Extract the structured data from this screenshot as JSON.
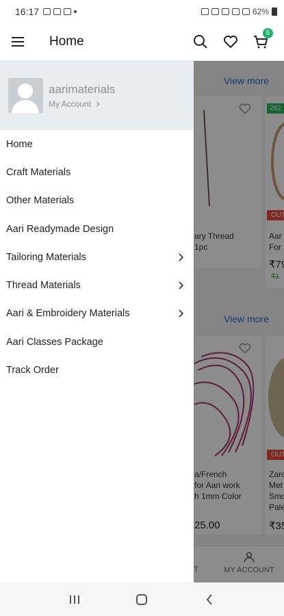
{
  "status_bar": {
    "time": "16:17",
    "battery": "62%"
  },
  "header": {
    "title": "Home",
    "cart_count": "6"
  },
  "drawer": {
    "username": "aarimaterials",
    "account_label": "My Account",
    "items": [
      {
        "label": "Home",
        "has_children": false
      },
      {
        "label": "Craft Materials",
        "has_children": false
      },
      {
        "label": "Other Materials",
        "has_children": false
      },
      {
        "label": "Aari Readymade Design",
        "has_children": false
      },
      {
        "label": "Tailoring Materials",
        "has_children": true
      },
      {
        "label": "Thread Materials",
        "has_children": true
      },
      {
        "label": "Aari & Embroidery Materials",
        "has_children": true
      },
      {
        "label": "Aari Classes Package",
        "has_children": false
      },
      {
        "label": "Track Order",
        "has_children": false
      }
    ]
  },
  "background": {
    "view_more_1": "View more",
    "view_more_2": "View more",
    "product_1_name": "ary Thread\n1pc",
    "product_2_name": "Aar\nFor",
    "product_2_price": "₹79",
    "product_2_mrp": "₹1",
    "product_2_discount": "282",
    "product_2_stock": "OUT",
    "product_3_name": "a/French\nfor Aari work\nh 1mm Color",
    "product_3_price": "25.00",
    "product_4_name": "Zaro\nMet\nSmo\nPale",
    "product_4_price": "₹35",
    "product_4_stock": "OUT",
    "nav_partial": "T",
    "nav_my_account": "MY ACCOUNT"
  },
  "colors": {
    "accent": "#2a6bd6",
    "badge": "#20b26b",
    "out_of_stock": "#e74c3c"
  }
}
